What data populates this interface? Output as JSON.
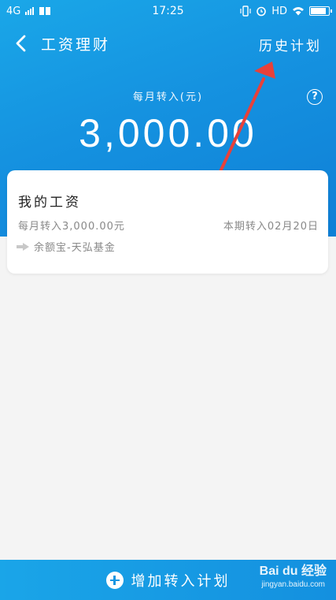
{
  "status_bar": {
    "network": "4G",
    "time": "17:25",
    "hd": "HD",
    "icons": [
      "signal-icon",
      "book-icon",
      "vibrate-icon",
      "alarm-icon",
      "wifi-icon",
      "battery-icon"
    ]
  },
  "header": {
    "title": "工资理财",
    "history_link": "历史计划"
  },
  "summary": {
    "monthly_label": "每月转入(元)",
    "amount": "3,000.00",
    "help_symbol": "?"
  },
  "plan_card": {
    "title": "我的工资",
    "monthly_text": "每月转入3,000.00元",
    "period_text": "本期转入02月20日",
    "target_text": "余额宝-天弘基金"
  },
  "bottom": {
    "add_label": "增加转入计划"
  },
  "watermark": {
    "brand": "Bai du 经验",
    "url": "jingyan.baidu.com"
  },
  "colors": {
    "primary": "#1592e0",
    "annotation_arrow": "#e8413a",
    "background": "#f4f4f4"
  }
}
